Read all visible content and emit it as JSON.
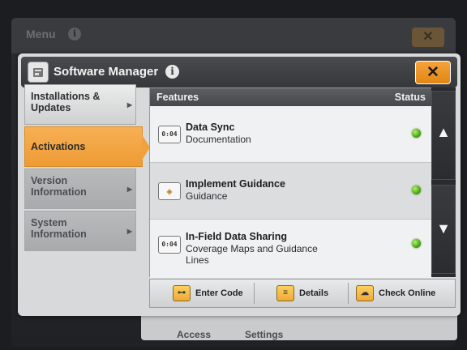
{
  "background": {
    "title": "Menu",
    "bottom_labels": [
      "Access",
      "Settings"
    ]
  },
  "dialog": {
    "title": "Software Manager",
    "close_glyph": "✕",
    "info_glyph": "i"
  },
  "sidebar": {
    "items": [
      {
        "label": "Installations & Updates",
        "state": "normal"
      },
      {
        "label": "Activations",
        "state": "active"
      },
      {
        "label": "Version Information",
        "state": "grey"
      },
      {
        "label": "System Information",
        "state": "grey"
      }
    ]
  },
  "table": {
    "header_features": "Features",
    "header_status": "Status",
    "rows": [
      {
        "name": "Data Sync",
        "category": "Documentation",
        "icon": "display-icon",
        "icon_text": "0:04",
        "status": "active"
      },
      {
        "name": "Implement Guidance",
        "category": "Guidance",
        "icon": "guidance-icon",
        "icon_text": "◈",
        "status": "active"
      },
      {
        "name": "In-Field Data Sharing",
        "category": "Coverage Maps and Guidance Lines",
        "icon": "display-icon",
        "icon_text": "0:04",
        "status": "active"
      }
    ]
  },
  "scroll": {
    "up": "▲",
    "down": "▼"
  },
  "toolbar": {
    "enter_code": "Enter Code",
    "details": "Details",
    "check_online": "Check Online"
  },
  "colors": {
    "accent": "#ee9b33",
    "status_ok": "#49a51a",
    "titlebar": "#3f4043"
  }
}
